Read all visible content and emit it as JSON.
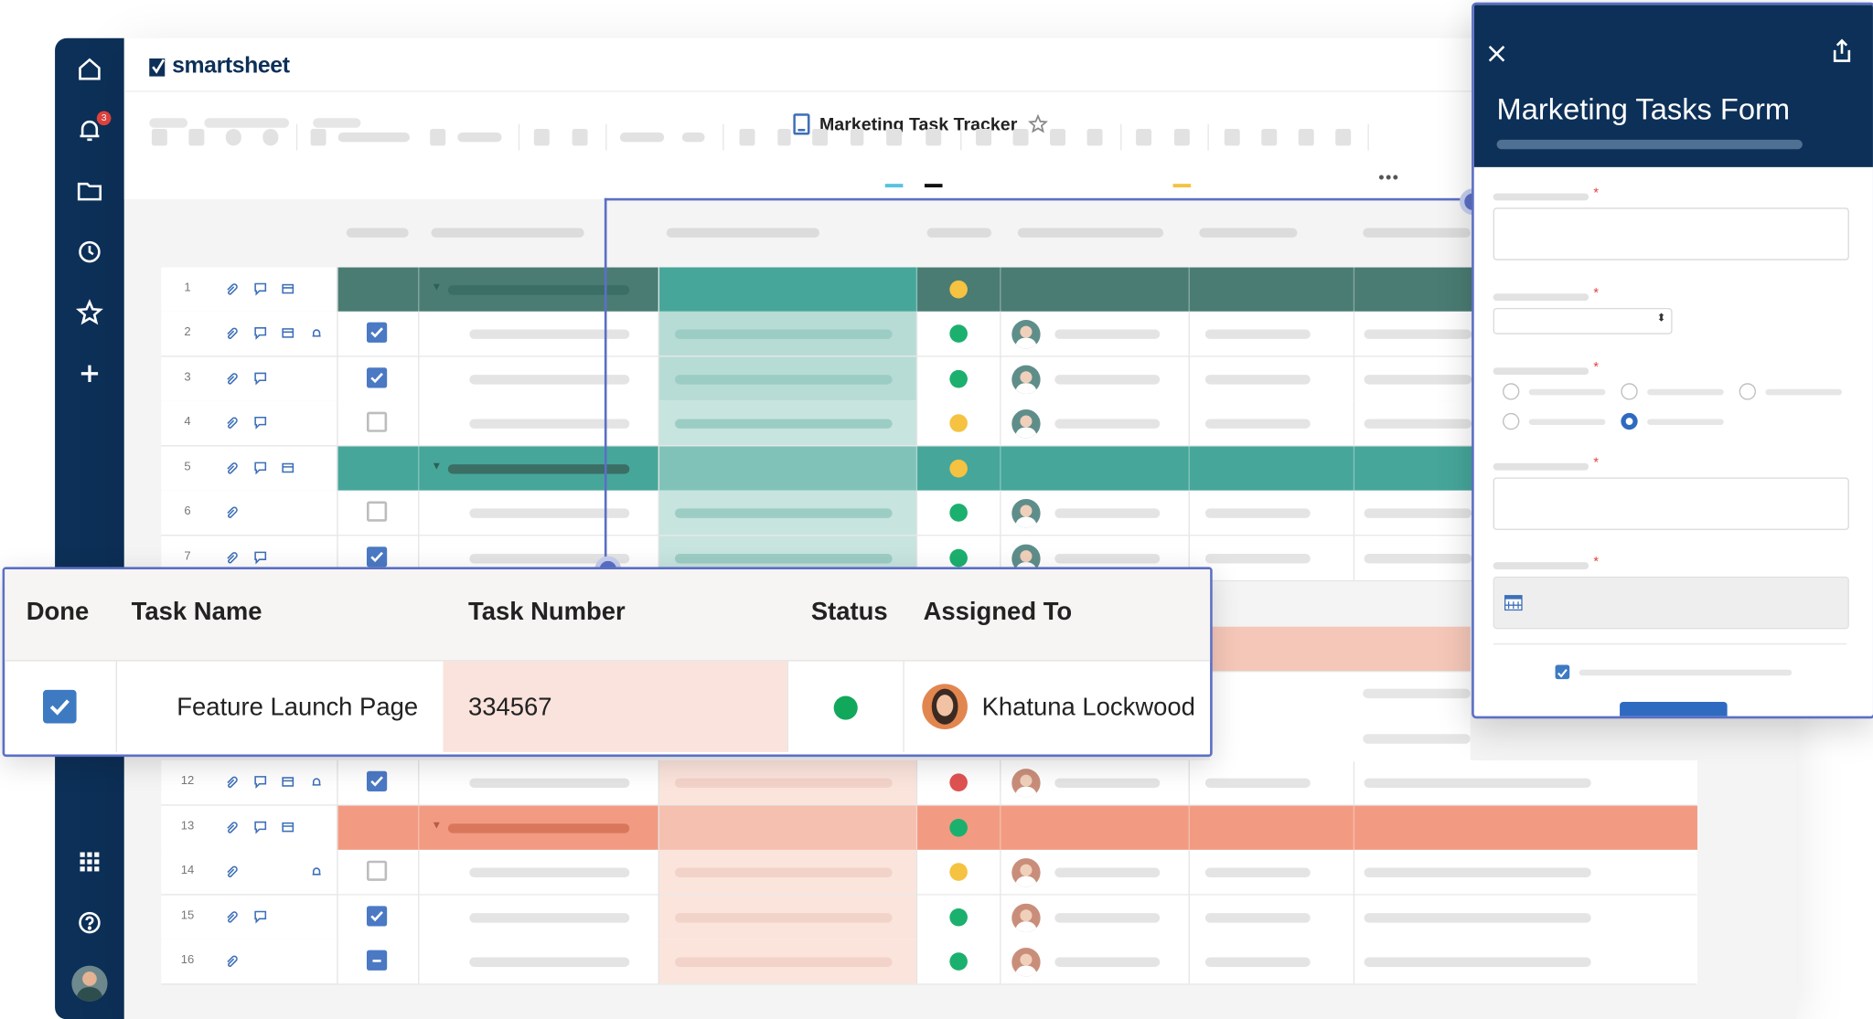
{
  "brand": {
    "name": "smartsheet"
  },
  "sheet": {
    "title": "Marketing Task Tracker"
  },
  "nav": {
    "notification_count": "3",
    "icons": [
      "home-icon",
      "bell-icon",
      "folder-icon",
      "clock-icon",
      "star-icon",
      "plus-icon",
      "apps-grid-icon",
      "help-icon",
      "user-avatar"
    ]
  },
  "grid": {
    "rows": [
      {
        "num": "1",
        "type": "parent",
        "theme": "teal",
        "status": "yellow",
        "icons": [
          "attach",
          "comment",
          "proof"
        ]
      },
      {
        "num": "2",
        "done": "checked",
        "status": "green",
        "icons": [
          "attach",
          "comment",
          "proof",
          "reminder"
        ]
      },
      {
        "num": "3",
        "done": "checked",
        "status": "green",
        "icons": [
          "attach",
          "comment"
        ]
      },
      {
        "num": "4",
        "done": "unchecked",
        "status": "yellow",
        "icons": [
          "attach",
          "comment"
        ]
      },
      {
        "num": "5",
        "type": "parent",
        "theme": "teal",
        "status": "yellow",
        "icons": [
          "attach",
          "comment",
          "proof"
        ]
      },
      {
        "num": "6",
        "done": "unchecked",
        "status": "green",
        "icons": [
          "attach"
        ]
      },
      {
        "num": "7",
        "done": "checked",
        "status": "green",
        "icons": [
          "attach",
          "comment"
        ]
      },
      {
        "num": "12",
        "done": "checked",
        "status": "red",
        "icons": [
          "attach",
          "comment",
          "proof",
          "reminder"
        ]
      },
      {
        "num": "13",
        "type": "parent",
        "theme": "salmon",
        "status": "green",
        "icons": [
          "attach",
          "comment",
          "proof"
        ]
      },
      {
        "num": "14",
        "done": "unchecked",
        "status": "yellow",
        "icons": [
          "attach",
          "reminder"
        ]
      },
      {
        "num": "15",
        "done": "checked",
        "status": "green",
        "icons": [
          "attach",
          "comment"
        ]
      },
      {
        "num": "16",
        "done": "partial",
        "status": "green",
        "icons": [
          "attach"
        ]
      }
    ]
  },
  "detail": {
    "headers": {
      "done": "Done",
      "task_name": "Task Name",
      "task_number": "Task Number",
      "status": "Status",
      "assigned_to": "Assigned To"
    },
    "row": {
      "done": "checked",
      "task_name": "Feature Launch Page",
      "task_number": "334567",
      "status": "green",
      "assigned_to": "Khatuna Lockwood"
    }
  },
  "form": {
    "title": "Marketing Tasks Form",
    "required_marker": "*"
  },
  "colors": {
    "navy": "#0d3058",
    "teal_dark": "#4a7c73",
    "teal": "#46a69a",
    "salmon": "#f29b82",
    "green": "#1cb06e",
    "yellow": "#f5c242",
    "red": "#e05252",
    "accent": "#5b6fc5",
    "checkbox": "#4b79c4"
  }
}
